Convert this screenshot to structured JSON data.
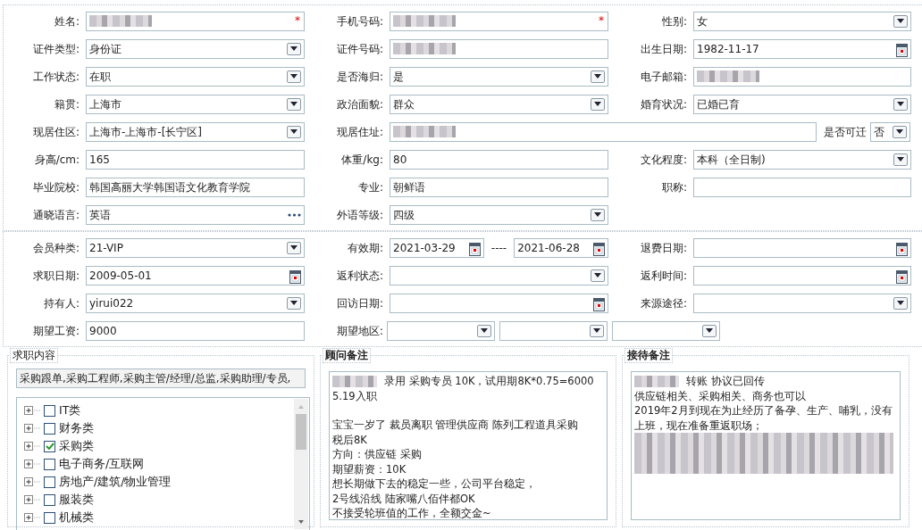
{
  "basic_info": {
    "rows": [
      {
        "items": [
          {
            "label": "姓名:",
            "kind": "text",
            "redacted": true,
            "required_mark": "*"
          },
          {
            "label": "手机号码:",
            "kind": "text",
            "redacted": true,
            "required_mark": "*"
          },
          {
            "label": "性别:",
            "kind": "select",
            "value": "女"
          }
        ]
      },
      {
        "items": [
          {
            "label": "证件类型:",
            "kind": "select",
            "value": "身份证"
          },
          {
            "label": "证件号码:",
            "kind": "text",
            "redacted": true
          },
          {
            "label": "出生日期:",
            "kind": "date",
            "value": "1982-11-17"
          }
        ]
      },
      {
        "items": [
          {
            "label": "工作状态:",
            "kind": "select",
            "value": "在职"
          },
          {
            "label": "是否海归:",
            "kind": "select",
            "value": "是"
          },
          {
            "label": "电子邮箱:",
            "kind": "text",
            "redacted": true
          }
        ]
      },
      {
        "items": [
          {
            "label": "籍贯:",
            "kind": "select",
            "value": "上海市"
          },
          {
            "label": "政治面貌:",
            "kind": "select",
            "value": "群众"
          },
          {
            "label": "婚育状况:",
            "kind": "select",
            "value": "已婚已育"
          }
        ]
      },
      {
        "items": [
          {
            "label": "现居住区:",
            "kind": "select",
            "value": " 上海市-上海市-[长宁区]"
          },
          {
            "label": "现居住址:",
            "kind": "address",
            "redacted": true,
            "movable": {
              "label": "是否可迁",
              "value": "否"
            }
          }
        ]
      },
      {
        "items": [
          {
            "label": "身高/cm:",
            "kind": "text",
            "value": "165"
          },
          {
            "label": "体重/kg:",
            "kind": "text",
            "value": "80"
          },
          {
            "label": "文化程度:",
            "kind": "select",
            "value": "本科（全日制)"
          }
        ]
      },
      {
        "items": [
          {
            "label": "毕业院校:",
            "kind": "text",
            "value": "韩国高丽大学韩国语文化教育学院"
          },
          {
            "label": "专业:",
            "kind": "text",
            "value": "朝鲜语"
          },
          {
            "label": "职称:",
            "kind": "text"
          }
        ]
      },
      {
        "items": [
          {
            "label": "通晓语言:",
            "kind": "lookup",
            "value": "英语"
          },
          {
            "label": "外语等级:",
            "kind": "select",
            "value": "四级"
          }
        ]
      }
    ]
  },
  "membership": {
    "rows": [
      {
        "items": [
          {
            "label": "会员种类:",
            "kind": "select",
            "value": " 21-VIP"
          },
          {
            "label": "有效期:",
            "kind": "date_range",
            "values": [
              "2021-03-29",
              "2021-06-28"
            ],
            "separator": "----"
          },
          {
            "label": "退费日期:",
            "kind": "date"
          }
        ]
      },
      {
        "items": [
          {
            "label": "求职日期:",
            "kind": "date",
            "value": "2009-05-01"
          },
          {
            "label": "返利状态:",
            "kind": "select"
          },
          {
            "label": "返利时间:",
            "kind": "date"
          }
        ]
      },
      {
        "items": [
          {
            "label": "持有人:",
            "kind": "select",
            "value": "yirui022"
          },
          {
            "label": "回访日期:",
            "kind": "date"
          },
          {
            "label": "来源途径:",
            "kind": "select"
          }
        ]
      },
      {
        "items": [
          {
            "label": "期望工资:",
            "kind": "text",
            "value": "9000"
          },
          {
            "label": "期望地区:",
            "kind": "select_group",
            "fields": [
              {
                "kind": "select"
              },
              {
                "kind": "select"
              },
              {
                "kind": "select"
              }
            ]
          }
        ]
      }
    ]
  },
  "job_content": {
    "legend": "求职内容",
    "summary": "采购跟单,采购工程师,采购主管/经理/总监,采购助理/专员,",
    "tree": [
      {
        "label": "IT类",
        "checked": false,
        "expanded": false
      },
      {
        "label": "财务类",
        "checked": false,
        "expanded": false
      },
      {
        "label": "采购类",
        "checked": true,
        "expanded": false
      },
      {
        "label": "电子商务/互联网",
        "checked": false,
        "expanded": false
      },
      {
        "label": "房地产/建筑/物业管理",
        "checked": false,
        "expanded": false
      },
      {
        "label": "服装类",
        "checked": false,
        "expanded": false
      },
      {
        "label": "机械类",
        "checked": false,
        "expanded": false
      }
    ]
  },
  "consultant_notes": {
    "legend": "顾问备注",
    "lines": [
      {
        "text": "录用 采购专员 10K，试用期8K*0.75=6000  5.19入职",
        "redacted_prefix": true
      },
      {
        "text": "宝宝一岁了  裁员离职 管理供应商 陈列工程道具采购",
        "gap_before": true
      },
      {
        "text": "税后8K"
      },
      {
        "text": "方向：供应链 采购"
      },
      {
        "text": "期望薪资：10K"
      },
      {
        "text": "想长期做下去的稳定一些，公司平台稳定，"
      },
      {
        "text": "2号线沿线 陆家嘴八佰伴都OK"
      },
      {
        "text": "不接受轮班值的工作，全额交金~"
      }
    ]
  },
  "reception_notes": {
    "legend": "接待备注",
    "lines": [
      {
        "text": "转账    协议已回传",
        "redacted_prefix": true
      },
      {
        "text": "供应链相关、采购相关、商务也可以"
      },
      {
        "text": "2019年2月到现在为止经历了备孕、生产、哺乳，没有上班，现在准备重返职场；",
        "redacted_after": true
      }
    ]
  }
}
